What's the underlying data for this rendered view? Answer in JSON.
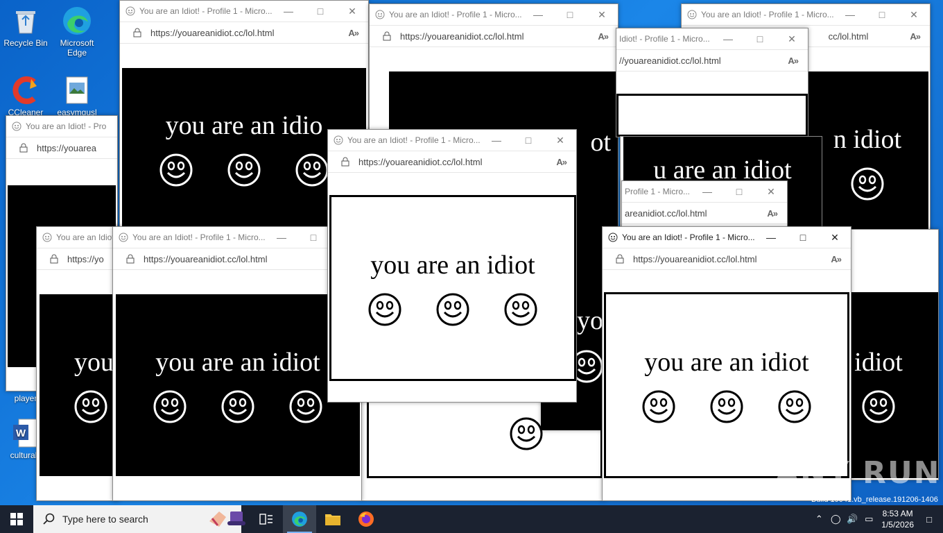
{
  "desktop": {
    "icons": [
      {
        "label": "Recycle Bin",
        "icon": "recycle-bin-icon"
      },
      {
        "label": "Microsoft Edge",
        "icon": "edge-icon"
      },
      {
        "label": "CCleaner",
        "icon": "ccleaner-icon"
      },
      {
        "label": "easymgusl",
        "icon": "image-file-icon"
      },
      {
        "label": "player",
        "icon": "player-icon"
      },
      {
        "label": "culturals",
        "icon": "word-doc-icon"
      }
    ]
  },
  "window": {
    "title": "You are an Idiot! - Profile 1 - Micro...",
    "title_short": "You are an Idiot! - Pro",
    "title_tail": "Profile 1 - Micro...",
    "title_tail2": "Idiot! - Profile 1 - Micro...",
    "title_mid": "You are an Idiot",
    "url": "https://youareanidiot.cc/lol.html",
    "url_short": "https://youarea",
    "url_short2": "https://yo",
    "url_tail": "//youareanidiot.cc/lol.html",
    "url_tail2": "areanidiot.cc/lol.html",
    "url_tail3": "cc/lol.html",
    "read_aloud": "A»",
    "message": "you are an idiot",
    "message_frag1": "you",
    "message_frag2": "n idiot",
    "message_frag3": "u are an idiot",
    "message_frag4": "yo",
    "message_frag5": "idiot",
    "message_frag6": "you are an idio",
    "message_frag7": "ot",
    "minimize": "—",
    "maximize": "□",
    "close": "✕"
  },
  "taskbar": {
    "search_placeholder": "Type here to search",
    "time": "8:53 AM",
    "date": "1/5/2026"
  },
  "watermark": "ANY RUN",
  "build_text": "Build 19041.vb_release.191206-1406"
}
